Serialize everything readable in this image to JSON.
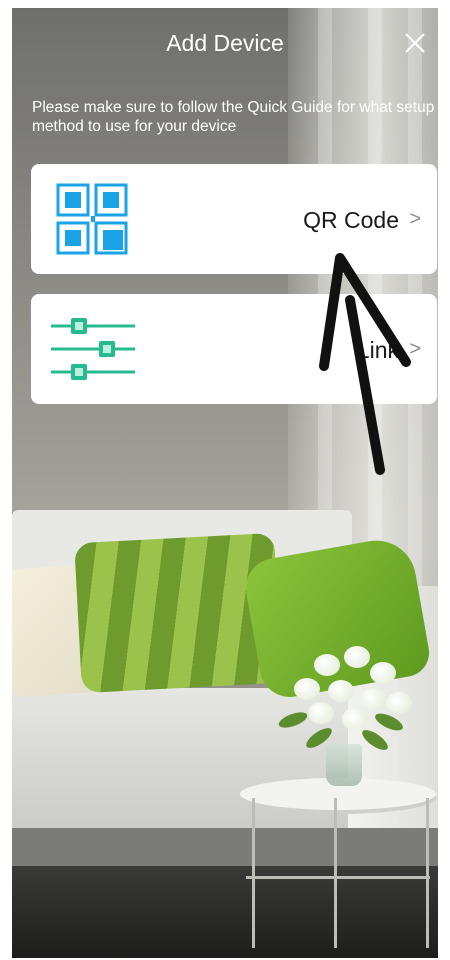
{
  "header": {
    "title": "Add Device",
    "close_icon": "close-icon"
  },
  "instructions": "Please make sure to follow the Quick Guide for what setup method to use for your device",
  "options": [
    {
      "label": "QR Code",
      "icon": "qr-code-icon",
      "chevron": ">"
    },
    {
      "label": "Link",
      "icon": "sliders-icon",
      "chevron": ">"
    }
  ],
  "colors": {
    "accent_blue": "#1aa3e6",
    "accent_green": "#27b98f",
    "card_bg": "#ffffff",
    "text_white": "#ffffff"
  }
}
